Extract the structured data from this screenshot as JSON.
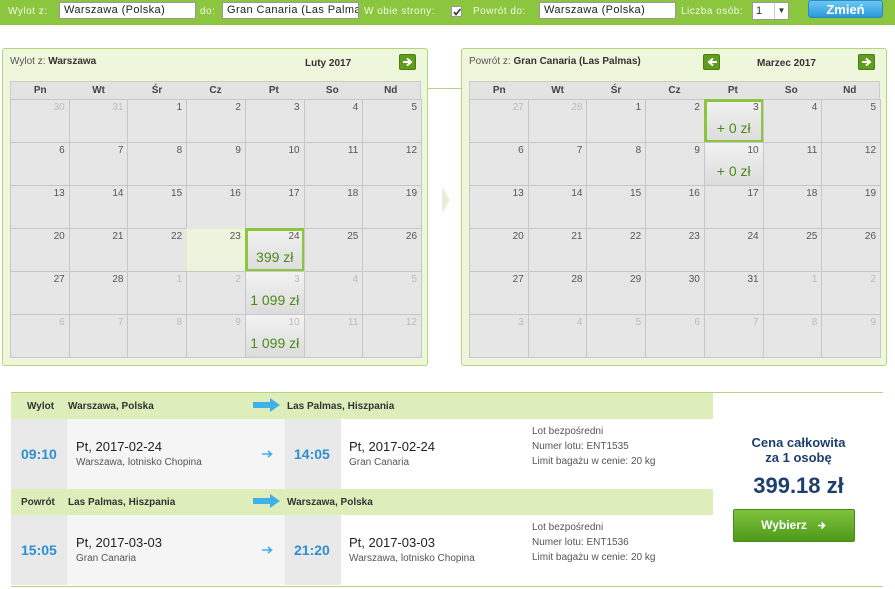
{
  "search": {
    "from_label": "Wylot z:",
    "from_value": "Warszawa (Polska)",
    "to_label": "do:",
    "to_value": "Gran Canaria (Las Palmas",
    "roundtrip_label": "W obie strony:",
    "roundtrip_checked": true,
    "return_label": "Powrót do:",
    "return_value": "Warszawa (Polska)",
    "pax_label": "Liczba osób:",
    "pax_value": "1",
    "change_button": "Zmień"
  },
  "calendar_out": {
    "route_prefix": "Wylot z:",
    "route_city": "Warszawa",
    "month": "Luty 2017",
    "weekdays": [
      "Pn",
      "Wt",
      "Śr",
      "Cz",
      "Pt",
      "So",
      "Nd"
    ],
    "weeks": [
      [
        {
          "d": "30",
          "m": 1
        },
        {
          "d": "31",
          "m": 1
        },
        {
          "d": "1"
        },
        {
          "d": "2"
        },
        {
          "d": "3"
        },
        {
          "d": "4"
        },
        {
          "d": "5"
        }
      ],
      [
        {
          "d": "6"
        },
        {
          "d": "7"
        },
        {
          "d": "8"
        },
        {
          "d": "9"
        },
        {
          "d": "10"
        },
        {
          "d": "11"
        },
        {
          "d": "12"
        }
      ],
      [
        {
          "d": "13"
        },
        {
          "d": "14"
        },
        {
          "d": "15"
        },
        {
          "d": "16"
        },
        {
          "d": "17"
        },
        {
          "d": "18"
        },
        {
          "d": "19"
        }
      ],
      [
        {
          "d": "20"
        },
        {
          "d": "21"
        },
        {
          "d": "22"
        },
        {
          "d": "23",
          "hl": 1
        },
        {
          "d": "24",
          "price": "399 zł",
          "sel": 1
        },
        {
          "d": "25"
        },
        {
          "d": "26"
        }
      ],
      [
        {
          "d": "27"
        },
        {
          "d": "28"
        },
        {
          "d": "1",
          "m": 1
        },
        {
          "d": "2",
          "m": 1
        },
        {
          "d": "3",
          "m": 1,
          "price": "1 099 zł"
        },
        {
          "d": "4",
          "m": 1
        },
        {
          "d": "5",
          "m": 1
        }
      ],
      [
        {
          "d": "6",
          "m": 1
        },
        {
          "d": "7",
          "m": 1
        },
        {
          "d": "8",
          "m": 1
        },
        {
          "d": "9",
          "m": 1
        },
        {
          "d": "10",
          "m": 1,
          "price": "1 099 zł"
        },
        {
          "d": "11",
          "m": 1
        },
        {
          "d": "12",
          "m": 1
        }
      ]
    ]
  },
  "calendar_ret": {
    "route_prefix": "Powrót z:",
    "route_city": "Gran Canaria (Las Palmas)",
    "month": "Marzec 2017",
    "weekdays": [
      "Pn",
      "Wt",
      "Śr",
      "Cz",
      "Pt",
      "So",
      "Nd"
    ],
    "weeks": [
      [
        {
          "d": "27",
          "m": 1
        },
        {
          "d": "28",
          "m": 1
        },
        {
          "d": "1"
        },
        {
          "d": "2"
        },
        {
          "d": "3",
          "price": "+ 0 zł",
          "sel": 1
        },
        {
          "d": "4"
        },
        {
          "d": "5"
        }
      ],
      [
        {
          "d": "6"
        },
        {
          "d": "7"
        },
        {
          "d": "8"
        },
        {
          "d": "9"
        },
        {
          "d": "10",
          "price": "+ 0 zł"
        },
        {
          "d": "11"
        },
        {
          "d": "12"
        }
      ],
      [
        {
          "d": "13"
        },
        {
          "d": "14"
        },
        {
          "d": "15"
        },
        {
          "d": "16"
        },
        {
          "d": "17"
        },
        {
          "d": "18"
        },
        {
          "d": "19"
        }
      ],
      [
        {
          "d": "20"
        },
        {
          "d": "21"
        },
        {
          "d": "22"
        },
        {
          "d": "23"
        },
        {
          "d": "24"
        },
        {
          "d": "25"
        },
        {
          "d": "26"
        }
      ],
      [
        {
          "d": "27"
        },
        {
          "d": "28"
        },
        {
          "d": "29"
        },
        {
          "d": "30"
        },
        {
          "d": "31"
        },
        {
          "d": "1",
          "m": 1
        },
        {
          "d": "2",
          "m": 1
        }
      ],
      [
        {
          "d": "3",
          "m": 1
        },
        {
          "d": "4",
          "m": 1
        },
        {
          "d": "5",
          "m": 1
        },
        {
          "d": "6",
          "m": 1
        },
        {
          "d": "7",
          "m": 1
        },
        {
          "d": "8",
          "m": 1
        },
        {
          "d": "9",
          "m": 1
        }
      ]
    ]
  },
  "outbound": {
    "label": "Wylot",
    "from": "Warszawa, Polska",
    "to": "Las Palmas, Hiszpania",
    "dep_time": "09:10",
    "dep_date": "Pt, 2017-02-24",
    "dep_place": "Warszawa, lotnisko Chopina",
    "arr_time": "14:05",
    "arr_date": "Pt, 2017-02-24",
    "arr_place": "Gran Canaria",
    "info1": "Lot bezpośredni",
    "info2": "Numer lotu: ENT1535",
    "info3": "Limit bagażu w cenie: 20 kg"
  },
  "inbound": {
    "label": "Powrót",
    "from": "Las Palmas, Hiszpania",
    "to": "Warszawa, Polska",
    "dep_time": "15:05",
    "dep_date": "Pt, 2017-03-03",
    "dep_place": "Gran Canaria",
    "arr_time": "21:20",
    "arr_date": "Pt, 2017-03-03",
    "arr_place": "Warszawa, lotnisko Chopina",
    "info1": "Lot bezpośredni",
    "info2": "Numer lotu: ENT1536",
    "info3": "Limit bagażu w cenie: 20 kg"
  },
  "price": {
    "title_line1": "Cena całkowita",
    "title_line2": "za 1 osobę",
    "value": "399.18 zł",
    "select_button": "Wybierz"
  },
  "colors": {
    "accent": "#8cc63f",
    "price_blue": "#1d3f6e",
    "time_blue": "#2e8fcf"
  }
}
